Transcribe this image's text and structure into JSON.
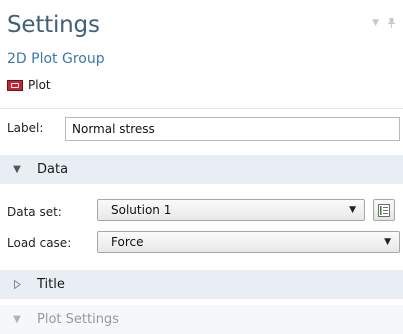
{
  "header": {
    "title": "Settings",
    "subtitle": "2D Plot Group",
    "plot_button_label": "Plot"
  },
  "label_field": {
    "label": "Label:",
    "value": "Normal stress"
  },
  "sections": {
    "data": "Data",
    "title": "Title",
    "plot_settings": "Plot Settings"
  },
  "data_set": {
    "label": "Data set:",
    "value": "Solution 1"
  },
  "load_case": {
    "label": "Load case:",
    "value": "Force"
  },
  "colors": {
    "title": "#41607a",
    "subtitle": "#3d76ad",
    "section_bg": "#e9eef5",
    "plot_icon": "#c72331"
  },
  "icons": {
    "pin": "pin-icon",
    "dropdown": "chevron-down-icon",
    "plot": "plot-icon",
    "goto_source": "go-to-source-icon"
  }
}
